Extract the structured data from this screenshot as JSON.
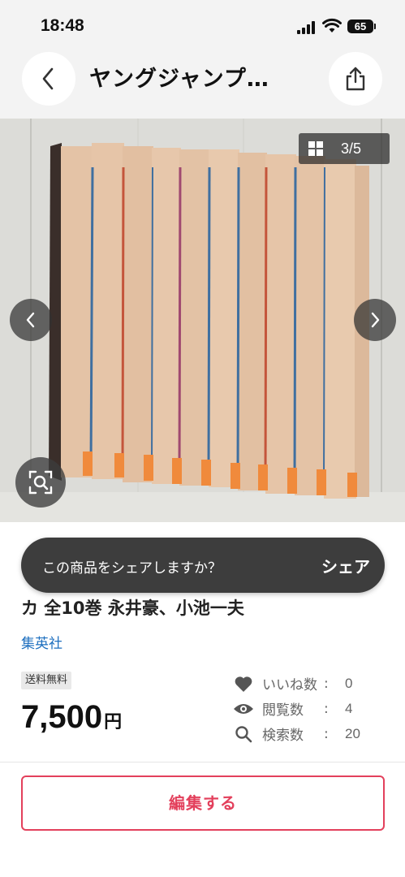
{
  "status_bar": {
    "time": "18:48",
    "battery": "65"
  },
  "header": {
    "title": "ヤングジャンプ…"
  },
  "gallery": {
    "counter": "3/5"
  },
  "toast": {
    "message": "この商品をシェアしますか？",
    "action": "シェア"
  },
  "product": {
    "title": "カ 全10巻 永井豪、小池一夫",
    "publisher": "集英社",
    "shipping_badge": "送料無料",
    "price": "7,500",
    "price_unit": "円"
  },
  "stats": [
    {
      "icon": "heart-icon",
      "label": "いいね数",
      "sep": ":",
      "value": "0"
    },
    {
      "icon": "eye-icon",
      "label": "閲覧数",
      "sep": ":",
      "value": "4"
    },
    {
      "icon": "search-icon",
      "label": "検索数",
      "sep": ":",
      "value": "20"
    }
  ],
  "actions": {
    "edit_label": "編集する"
  },
  "colors": {
    "accent": "#e3405c",
    "link": "#1e6fbf",
    "toast_bg": "#3d3d3d"
  }
}
